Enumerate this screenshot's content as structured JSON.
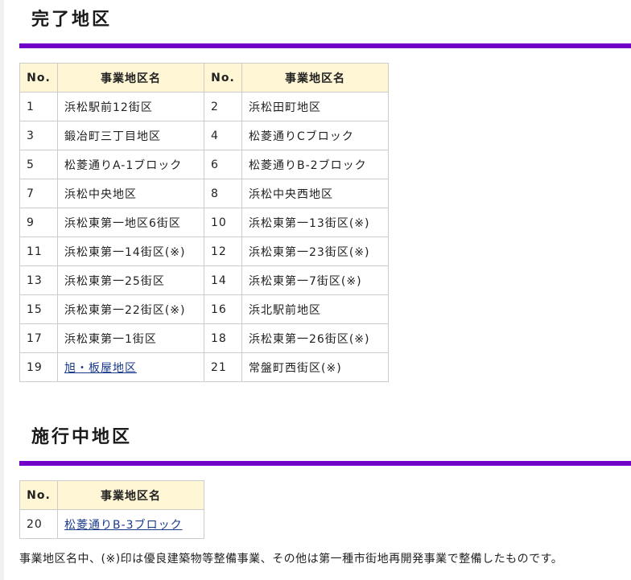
{
  "completed": {
    "title": "完了地区",
    "headers": {
      "no": "No.",
      "name": "事業地区名"
    },
    "rows": [
      {
        "left_no": "1",
        "left_name": "浜松駅前12街区",
        "right_no": "2",
        "right_name": "浜松田町地区"
      },
      {
        "left_no": "3",
        "left_name": "鍛冶町三丁目地区",
        "right_no": "4",
        "right_name": "松菱通りCブロック"
      },
      {
        "left_no": "5",
        "left_name": "松菱通りA-1ブロック",
        "right_no": "6",
        "right_name": "松菱通りB-2ブロック"
      },
      {
        "left_no": "7",
        "left_name": "浜松中央地区",
        "right_no": "8",
        "right_name": "浜松中央西地区"
      },
      {
        "left_no": "9",
        "left_name": "浜松東第一地区6街区",
        "right_no": "10",
        "right_name": "浜松東第一13街区(※)"
      },
      {
        "left_no": "11",
        "left_name": "浜松東第一14街区(※)",
        "right_no": "12",
        "right_name": "浜松東第一23街区(※)"
      },
      {
        "left_no": "13",
        "left_name": "浜松東第一25街区",
        "right_no": "14",
        "right_name": "浜松東第一7街区(※)"
      },
      {
        "left_no": "15",
        "left_name": "浜松東第一22街区(※)",
        "right_no": "16",
        "right_name": "浜北駅前地区"
      },
      {
        "left_no": "17",
        "left_name": "浜松東第一1街区",
        "right_no": "18",
        "right_name": "浜松東第一26街区(※)"
      },
      {
        "left_no": "19",
        "left_name": "旭・板屋地区",
        "right_no": "21",
        "right_name": "常盤町西街区(※)"
      }
    ]
  },
  "in_progress": {
    "title": "施行中地区",
    "headers": {
      "no": "No.",
      "name": "事業地区名"
    },
    "rows": [
      {
        "no": "20",
        "name": "松菱通りB-3ブロック"
      }
    ]
  },
  "note": "事業地区名中、(※)印は優良建築物等整備事業、その他は第一種市街地再開発事業で整備したものです。",
  "colors": {
    "accent_bar": "#7000c8",
    "header_bg": "#fff6d5",
    "link": "#1a3a8a"
  }
}
